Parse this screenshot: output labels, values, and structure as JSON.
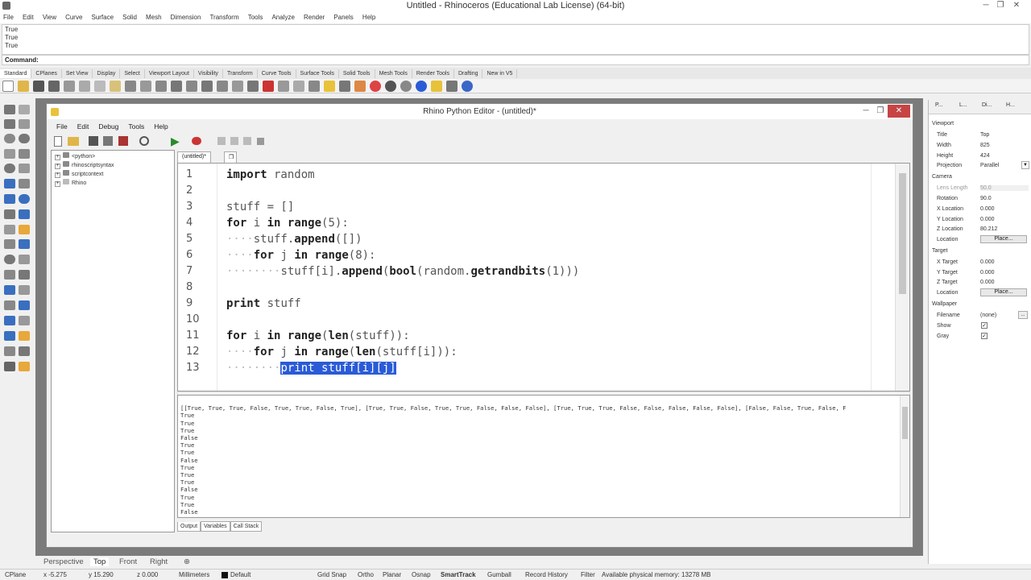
{
  "app": {
    "title": "Untitled - Rhinoceros (Educational Lab License) (64-bit)",
    "menu": [
      "File",
      "Edit",
      "View",
      "Curve",
      "Surface",
      "Solid",
      "Mesh",
      "Dimension",
      "Transform",
      "Tools",
      "Analyze",
      "Render",
      "Panels",
      "Help"
    ],
    "history": [
      "True",
      "True",
      "True"
    ],
    "command_label": "Command:",
    "toolbar_tabs": [
      "Standard",
      "CPlanes",
      "Set View",
      "Display",
      "Select",
      "Viewport Layout",
      "Visibility",
      "Transform",
      "Curve Tools",
      "Surface Tools",
      "Solid Tools",
      "Mesh Tools",
      "Render Tools",
      "Drafting",
      "New in V5"
    ]
  },
  "editor": {
    "title": "Rhino Python Editor - (untitled)*",
    "menu": [
      "File",
      "Edit",
      "Debug",
      "Tools",
      "Help"
    ],
    "tree": [
      "<python>",
      "rhinoscriptsyntax",
      "scriptcontext",
      "Rhino"
    ],
    "doc_tab": "(untitled)*",
    "code_lines": [
      {
        "n": "1",
        "code": "import random"
      },
      {
        "n": "2",
        "code": ""
      },
      {
        "n": "3",
        "code": "stuff = []"
      },
      {
        "n": "4",
        "code": "for i in range(5):"
      },
      {
        "n": "5",
        "code": "····stuff.append([])"
      },
      {
        "n": "6",
        "code": "····for j in range(8):"
      },
      {
        "n": "7",
        "code": "········stuff[i].append(bool(random.getrandbits(1)))"
      },
      {
        "n": "8",
        "code": ""
      },
      {
        "n": "9",
        "code": "print stuff"
      },
      {
        "n": "10",
        "code": ""
      },
      {
        "n": "11",
        "code": "for i in range(len(stuff)):"
      },
      {
        "n": "12",
        "code": "····for j in range(len(stuff[i])):"
      },
      {
        "n": "13",
        "code": "········print stuff[i][j]"
      }
    ],
    "output_first_line": "[[True, True, True, False, True, True, False, True], [True, True, False, True, True, False, False, False], [True, True, True, False, False, False, False, False], [False, False, True, False, F",
    "output_lines": [
      "True",
      "True",
      "True",
      "False",
      "True",
      "True",
      "False",
      "True",
      "True",
      "True",
      "False",
      "True",
      "True",
      "False"
    ],
    "output_tabs": [
      "Output",
      "Variables",
      "Call Stack"
    ]
  },
  "properties": {
    "tabs": [
      "P...",
      "L...",
      "Di...",
      "H..."
    ],
    "viewport_header": "Viewport",
    "title_label": "Title",
    "title_value": "Top",
    "width_label": "Width",
    "width_value": "825",
    "height_label": "Height",
    "height_value": "424",
    "projection_label": "Projection",
    "projection_value": "Parallel",
    "camera_header": "Camera",
    "lens_label": "Lens Length",
    "lens_value": "50.0",
    "rotation_label": "Rotation",
    "rotation_value": "90.0",
    "xloc_label": "X Location",
    "xloc_value": "0.000",
    "yloc_label": "Y Location",
    "yloc_value": "0.000",
    "zloc_label": "Z Location",
    "zloc_value": "80.212",
    "location_label": "Location",
    "place_label": "Place...",
    "target_header": "Target",
    "xtarget_label": "X Target",
    "xtarget_value": "0.000",
    "ytarget_label": "Y Target",
    "ytarget_value": "0.000",
    "ztarget_label": "Z Target",
    "ztarget_value": "0.000",
    "target_location_label": "Location",
    "target_place_label": "Place...",
    "wallpaper_header": "Wallpaper",
    "filename_label": "Filename",
    "filename_value": "(none)",
    "show_label": "Show",
    "gray_label": "Gray",
    "checkmark": "✓"
  },
  "viewport_tabs": [
    "Perspective",
    "Top",
    "Front",
    "Right"
  ],
  "status": {
    "cplane": "CPlane",
    "x": "x -5.275",
    "y": "y 15.290",
    "z": "z 0.000",
    "units": "Millimeters",
    "layer": "Default",
    "toggles": [
      "Grid Snap",
      "Ortho",
      "Planar",
      "Osnap",
      "SmartTrack",
      "Gumball",
      "Record History",
      "Filter"
    ],
    "memory": "Available physical memory: 13278 MB"
  }
}
